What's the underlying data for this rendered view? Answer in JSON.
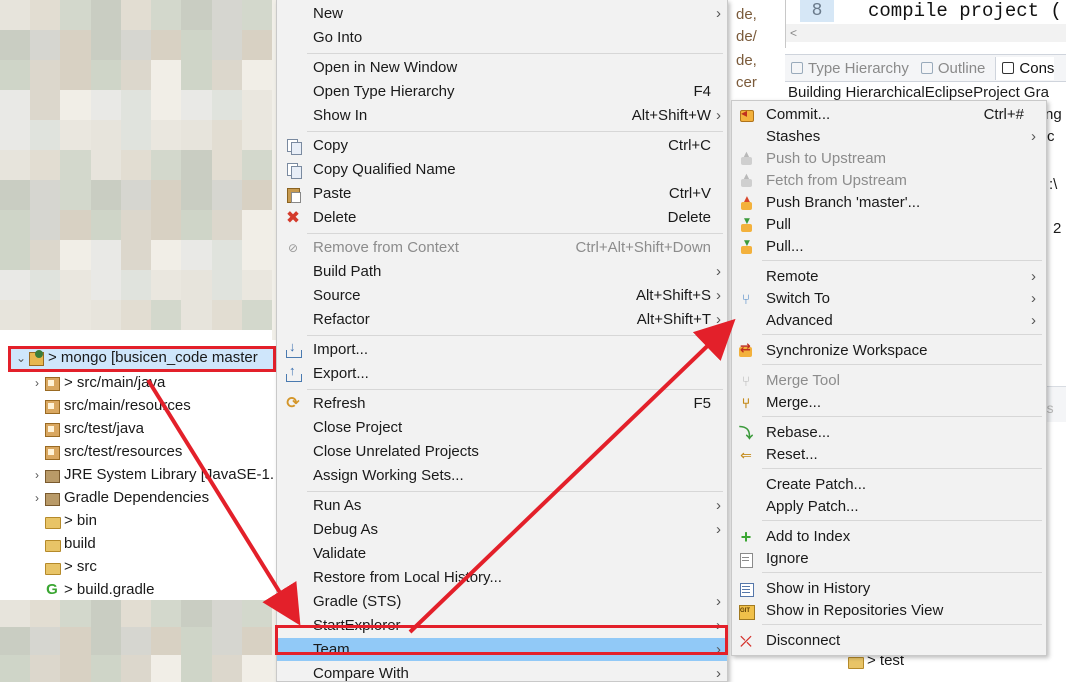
{
  "colors": {
    "highlight_box": "#e3202a",
    "arrow": "#e3202a",
    "menu_bg": "#f2f2f2",
    "selected_item": "#91c9f7"
  },
  "project_tree": {
    "root_label": "> mongo [busicen_code master",
    "items": [
      {
        "label": "> src/main/java",
        "icon": "package-folder-icon",
        "expandable": true
      },
      {
        "label": "src/main/resources",
        "icon": "package-folder-icon",
        "expandable": false
      },
      {
        "label": "src/test/java",
        "icon": "package-folder-icon",
        "expandable": false
      },
      {
        "label": "src/test/resources",
        "icon": "package-folder-icon",
        "expandable": false
      },
      {
        "label": "JRE System Library [JavaSE-1.",
        "icon": "library-icon",
        "expandable": true
      },
      {
        "label": "Gradle Dependencies",
        "icon": "library-icon",
        "expandable": true
      },
      {
        "label": "> bin",
        "icon": "folder-icon",
        "expandable": false
      },
      {
        "label": "build",
        "icon": "folder-icon",
        "expandable": false
      },
      {
        "label": "> src",
        "icon": "folder-icon",
        "expandable": false
      },
      {
        "label": "> build.gradle",
        "icon": "gradle-file-icon",
        "expandable": false
      }
    ]
  },
  "middle_column": [
    "de,",
    "de/",
    "de,",
    "cer"
  ],
  "editor": {
    "line_number": "8",
    "code_text": "compile project ('"
  },
  "views": {
    "tabs": [
      "Type Hierarchy",
      "Outline",
      "Cons"
    ]
  },
  "console": {
    "lines": [
      "Building HierarchicalEclipseProject Gra",
      "ng",
      "c",
      ":\\",
      "2"
    ]
  },
  "right_lower": {
    "ghost_text": "nts",
    "tree_item": "> test"
  },
  "context_menu": {
    "items": [
      {
        "label": "New",
        "submenu": true
      },
      {
        "label": "Go Into"
      },
      {
        "sep": true
      },
      {
        "label": "Open in New Window"
      },
      {
        "label": "Open Type Hierarchy",
        "shortcut": "F4"
      },
      {
        "label": "Show In",
        "shortcut": "Alt+Shift+W",
        "submenu": true
      },
      {
        "sep": true
      },
      {
        "label": "Copy",
        "shortcut": "Ctrl+C",
        "icon": "copy-icon"
      },
      {
        "label": "Copy Qualified Name",
        "icon": "copy-icon"
      },
      {
        "label": "Paste",
        "shortcut": "Ctrl+V",
        "icon": "paste-icon"
      },
      {
        "label": "Delete",
        "shortcut": "Delete",
        "icon": "delete-icon"
      },
      {
        "sep": true
      },
      {
        "label": "Remove from Context",
        "shortcut": "Ctrl+Alt+Shift+Down",
        "disabled": true,
        "icon": "remove-icon"
      },
      {
        "label": "Build Path",
        "submenu": true
      },
      {
        "label": "Source",
        "shortcut": "Alt+Shift+S",
        "submenu": true
      },
      {
        "label": "Refactor",
        "shortcut": "Alt+Shift+T",
        "submenu": true
      },
      {
        "sep": true
      },
      {
        "label": "Import...",
        "icon": "import-icon"
      },
      {
        "label": "Export...",
        "icon": "export-icon"
      },
      {
        "sep": true
      },
      {
        "label": "Refresh",
        "shortcut": "F5",
        "icon": "refresh-icon"
      },
      {
        "label": "Close Project"
      },
      {
        "label": "Close Unrelated Projects"
      },
      {
        "label": "Assign Working Sets..."
      },
      {
        "sep": true
      },
      {
        "label": "Run As",
        "submenu": true
      },
      {
        "label": "Debug As",
        "submenu": true
      },
      {
        "label": "Validate"
      },
      {
        "label": "Restore from Local History..."
      },
      {
        "label": "Gradle (STS)",
        "submenu": true
      },
      {
        "label": "StartExplorer",
        "submenu": true
      },
      {
        "label": "Team",
        "submenu": true,
        "highlighted": true
      },
      {
        "label": "Compare With",
        "submenu": true
      }
    ]
  },
  "team_menu": {
    "items": [
      {
        "label": "Commit...",
        "shortcut": "Ctrl+#",
        "icon": "commit-icon"
      },
      {
        "label": "Stashes",
        "submenu": true
      },
      {
        "label": "Push to Upstream",
        "disabled": true,
        "icon": "push-upstream-icon"
      },
      {
        "label": "Fetch from Upstream",
        "disabled": true,
        "icon": "fetch-upstream-icon"
      },
      {
        "label": "Push Branch 'master'...",
        "icon": "push-branch-icon"
      },
      {
        "label": "Pull",
        "icon": "pull-icon"
      },
      {
        "label": "Pull...",
        "icon": "pull-icon"
      },
      {
        "sep": true
      },
      {
        "label": "Remote",
        "submenu": true
      },
      {
        "label": "Switch To",
        "submenu": true,
        "icon": "switch-branch-icon"
      },
      {
        "label": "Advanced",
        "submenu": true
      },
      {
        "sep": true
      },
      {
        "label": "Synchronize Workspace",
        "icon": "synchronize-icon"
      },
      {
        "sep": true
      },
      {
        "label": "Merge Tool",
        "disabled": true,
        "icon": "merge-tool-icon"
      },
      {
        "label": "Merge...",
        "icon": "merge-icon"
      },
      {
        "sep": true
      },
      {
        "label": "Rebase...",
        "icon": "rebase-icon"
      },
      {
        "label": "Reset...",
        "icon": "reset-icon"
      },
      {
        "sep": true
      },
      {
        "label": "Create Patch..."
      },
      {
        "label": "Apply Patch..."
      },
      {
        "sep": true
      },
      {
        "label": "Add to Index",
        "icon": "add-icon"
      },
      {
        "label": "Ignore",
        "icon": "ignore-icon"
      },
      {
        "sep": true
      },
      {
        "label": "Show in History",
        "icon": "history-icon"
      },
      {
        "label": "Show in Repositories View",
        "icon": "repositories-icon"
      },
      {
        "sep": true
      },
      {
        "label": "Disconnect",
        "icon": "disconnect-icon"
      }
    ]
  }
}
